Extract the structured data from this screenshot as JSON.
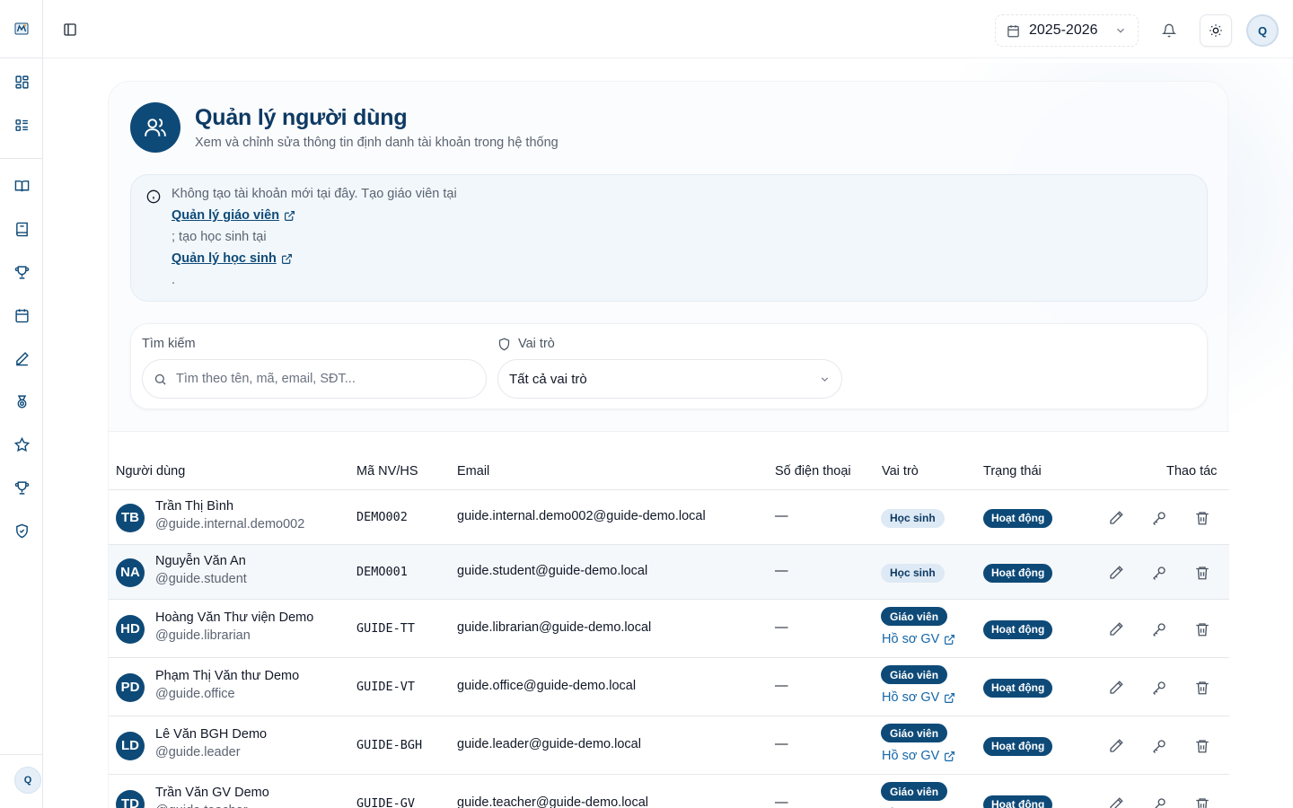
{
  "topbar": {
    "year": "2025-2026",
    "avatar_initial": "Q"
  },
  "sidebar": {
    "avatar_initial": "Q",
    "icons": [
      "layout-grid-icon",
      "list-icon",
      "book-open-icon",
      "book-icon",
      "trophy-icon",
      "calendar-icon",
      "pencil-icon",
      "medal-icon",
      "star-icon",
      "trophy-icon",
      "shield-check-icon"
    ]
  },
  "page": {
    "title": "Quản lý người dùng",
    "subtitle": "Xem và chỉnh sửa thông tin định danh tài khoản trong hệ thống"
  },
  "notice": {
    "line1": "Không tạo tài khoản mới tại đây. Tạo giáo viên tại",
    "link1": "Quản lý giáo viên",
    "line2": "; tạo học sinh tại",
    "link2": "Quản lý học sinh",
    "line3": "."
  },
  "filters": {
    "search_label": "Tìm kiếm",
    "search_placeholder": "Tìm theo tên, mã, email, SĐT...",
    "role_label": "Vai trò",
    "role_value": "Tất cả vai trò"
  },
  "table": {
    "headers": {
      "user": "Người dùng",
      "code": "Mã NV/HS",
      "email": "Email",
      "phone": "Số điện thoại",
      "role": "Vai trò",
      "status": "Trạng thái",
      "actions": "Thao tác"
    },
    "profile_link": "Hồ sơ GV",
    "rows": [
      {
        "initials": "TB",
        "name": "Trần Thị Bình",
        "handle": "@guide.internal.demo002",
        "code": "DEMO002",
        "email": "guide.internal.demo002@guide-demo.local",
        "phone": "—",
        "role": "Học sinh",
        "status": "Hoạt động"
      },
      {
        "initials": "NA",
        "name": "Nguyễn Văn An",
        "handle": "@guide.student",
        "code": "DEMO001",
        "email": "guide.student@guide-demo.local",
        "phone": "—",
        "role": "Học sinh",
        "status": "Hoạt động"
      },
      {
        "initials": "HD",
        "name": "Hoàng Văn Thư viện Demo",
        "handle": "@guide.librarian",
        "code": "GUIDE-TT",
        "email": "guide.librarian@guide-demo.local",
        "phone": "—",
        "role": "Giáo viên",
        "status": "Hoạt động"
      },
      {
        "initials": "PD",
        "name": "Phạm Thị Văn thư Demo",
        "handle": "@guide.office",
        "code": "GUIDE-VT",
        "email": "guide.office@guide-demo.local",
        "phone": "—",
        "role": "Giáo viên",
        "status": "Hoạt động"
      },
      {
        "initials": "LD",
        "name": "Lê Văn BGH Demo",
        "handle": "@guide.leader",
        "code": "GUIDE-BGH",
        "email": "guide.leader@guide-demo.local",
        "phone": "—",
        "role": "Giáo viên",
        "status": "Hoạt động"
      },
      {
        "initials": "TD",
        "name": "Trần Văn GV Demo",
        "handle": "@guide.teacher",
        "code": "GUIDE-GV",
        "email": "guide.teacher@guide-demo.local",
        "phone": "—",
        "role": "Giáo viên",
        "status": "Hoạt động"
      }
    ]
  }
}
